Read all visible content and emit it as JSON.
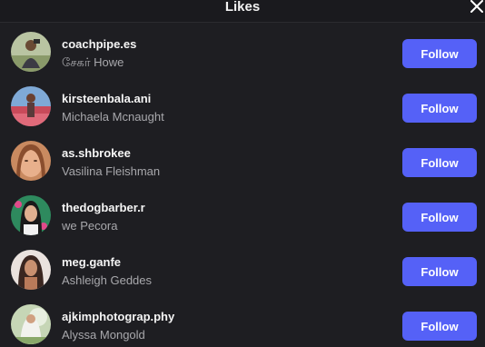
{
  "header": {
    "title": "Likes"
  },
  "likes": [
    {
      "username": "coachpipe.es",
      "full_name": "சேகர் Howe",
      "button": "Follow"
    },
    {
      "username": "kirsteenbala.ani",
      "full_name": "Michaela Mcnaught",
      "button": "Follow"
    },
    {
      "username": "as.shbrokee",
      "full_name": "Vasilina Fleishman",
      "button": "Follow"
    },
    {
      "username": "thedogbarber.r",
      "full_name": "we Pecora",
      "button": "Follow"
    },
    {
      "username": "meg.ganfe",
      "full_name": "Ashleigh Geddes",
      "button": "Follow"
    },
    {
      "username": "ajkimphotograp.phy",
      "full_name": "Alyssa Mongold",
      "button": "Follow"
    }
  ],
  "colors": {
    "accent": "#5561f7",
    "background": "#1e1e22"
  },
  "icons": {
    "close": "close-icon"
  }
}
